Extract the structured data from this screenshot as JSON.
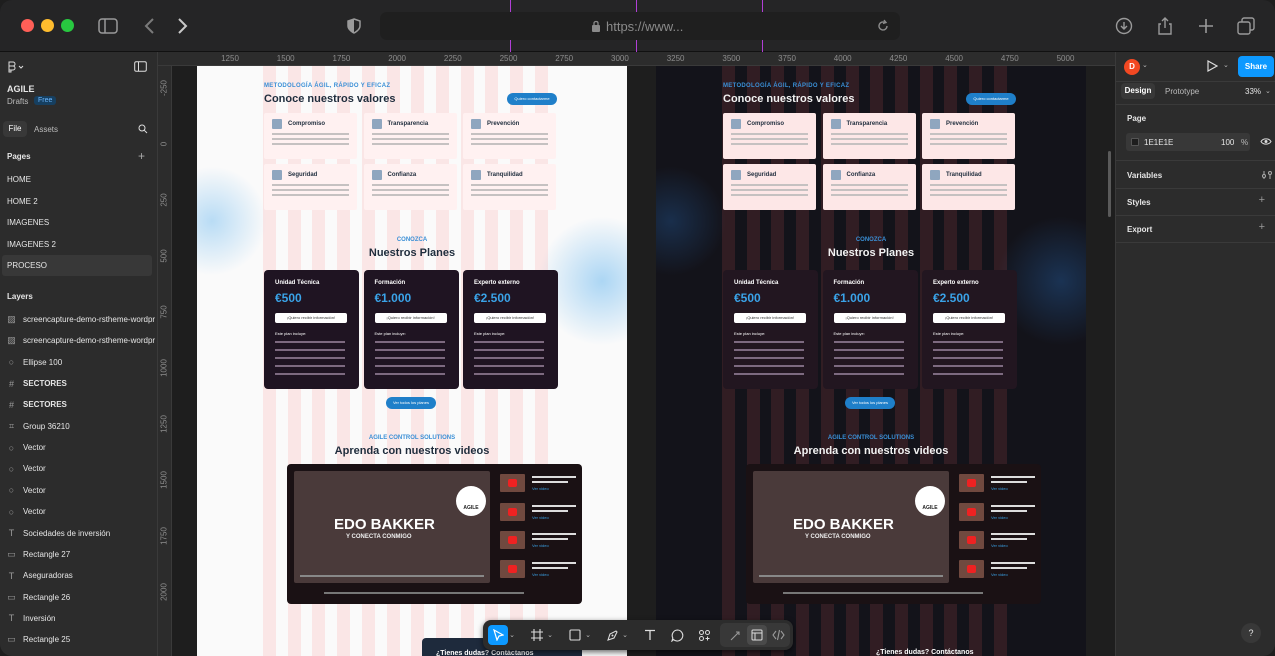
{
  "browser": {
    "url": "https://www..."
  },
  "ruler": {
    "top": [
      "1250",
      "1500",
      "1750",
      "2000",
      "2250",
      "2500",
      "2750",
      "3000",
      "3250",
      "3500",
      "3750",
      "4000",
      "4250",
      "4500",
      "4750",
      "5000"
    ],
    "left": [
      "-250",
      "0",
      "250",
      "500",
      "750",
      "1000",
      "1250",
      "1500",
      "1750",
      "2000"
    ]
  },
  "file": {
    "name": "AGILE",
    "drafts": "Drafts",
    "plan_badge": "Free",
    "tab_file": "File",
    "tab_assets": "Assets"
  },
  "pages": {
    "header": "Pages",
    "items": [
      "HOME",
      "HOME 2",
      "IMAGENES",
      "IMAGENES 2",
      "PROCESO"
    ],
    "selected": "PROCESO"
  },
  "layers": {
    "header": "Layers",
    "items": [
      {
        "icon": "image",
        "label": "screencapture-demo-rstheme-wordpr"
      },
      {
        "icon": "image",
        "label": "screencapture-demo-rstheme-wordpr"
      },
      {
        "icon": "ellipse",
        "label": "Ellipse 100"
      },
      {
        "icon": "frame",
        "label": "SECTORES"
      },
      {
        "icon": "frame",
        "label": "SECTORES"
      },
      {
        "icon": "group",
        "label": "Group 36210"
      },
      {
        "icon": "vector",
        "label": "Vector"
      },
      {
        "icon": "vector",
        "label": "Vector"
      },
      {
        "icon": "vector",
        "label": "Vector"
      },
      {
        "icon": "vector",
        "label": "Vector"
      },
      {
        "icon": "text",
        "label": "Sociedades de inversión"
      },
      {
        "icon": "rect",
        "label": "Rectangle 27"
      },
      {
        "icon": "text",
        "label": "Aseguradoras"
      },
      {
        "icon": "rect",
        "label": "Rectangle 26"
      },
      {
        "icon": "text",
        "label": "Inversión"
      },
      {
        "icon": "rect",
        "label": "Rectangle 25"
      }
    ]
  },
  "design": {
    "avatar": "D",
    "share": "Share",
    "tab_design": "Design",
    "tab_prototype": "Prototype",
    "zoom": "33%",
    "page_section": "Page",
    "page_color": "1E1E1E",
    "page_opacity": "100",
    "page_opacity_unit": "%",
    "sections": [
      "Variables",
      "Styles",
      "Export"
    ],
    "help": "?"
  },
  "website": {
    "eyebrow": "METODOLOGÍA ÁGIL, RÁPIDO Y EFICAZ",
    "values_title": "Conoce nuestros valores",
    "values_button": "Quiero contactarme",
    "values": [
      "Compromiso",
      "Transparencia",
      "Prevención",
      "Seguridad",
      "Confianza",
      "Tranquilidad"
    ],
    "plans_eyebrow": "CONOZCA",
    "plans_title": "Nuestros Planes",
    "plan_button": "¡Quiero recibir información!",
    "plan_includes": "Este plan incluye:",
    "plans": [
      {
        "name": "Unidad Técnica",
        "price": "€500"
      },
      {
        "name": "Formación",
        "price": "€1.000"
      },
      {
        "name": "Experto externo",
        "price": "€2.500"
      }
    ],
    "plans_more": "Ver todos los planes",
    "videos_eyebrow": "AGILE CONTROL SOLUTIONS",
    "videos_title": "Aprenda con nuestros videos",
    "video_main_line1": "EDO BAKKER",
    "video_main_line2": "Y CONECTA CONMIGO",
    "video_logo": "AGILE",
    "video_item": "Lorem ipsum sit dolor amet consectetur",
    "video_item_link": "Ver video",
    "footer_cta": "¿Tienes dudas? Contáctanos"
  }
}
